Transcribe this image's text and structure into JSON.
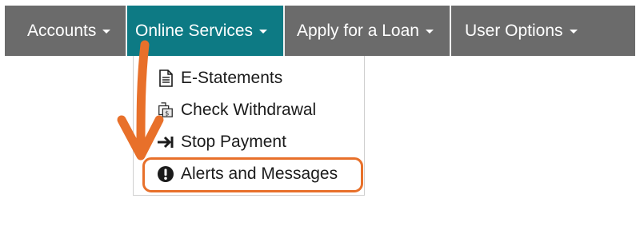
{
  "navbar": {
    "items": [
      {
        "label": "Accounts",
        "icon": "caret-down-icon"
      },
      {
        "label": "Online Services",
        "icon": "caret-down-icon",
        "active": true
      },
      {
        "label": "Apply for a Loan",
        "icon": "caret-down-icon"
      },
      {
        "label": "User Options",
        "icon": "caret-down-icon"
      }
    ],
    "background": "#6b6b6b",
    "active_background": "#0d7a84"
  },
  "dropdown": {
    "items": [
      {
        "label": "E-Statements",
        "icon": "document-icon"
      },
      {
        "label": "Check Withdrawal",
        "icon": "check-withdrawal-icon"
      },
      {
        "label": "Stop Payment",
        "icon": "arrow-to-bar-icon"
      },
      {
        "label": "Alerts and Messages",
        "icon": "exclamation-circle-icon",
        "highlighted": true
      }
    ]
  },
  "annotation": {
    "color": "#e8702a",
    "arrow_icon": "down-arrow-annotation",
    "highlight": "rounded-rectangle"
  }
}
